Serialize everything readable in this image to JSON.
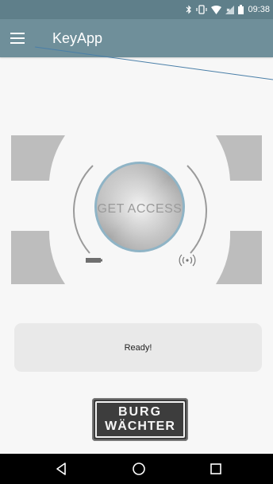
{
  "status_bar": {
    "time": "09:38",
    "icons": [
      "bluetooth-icon",
      "vibrate-icon",
      "wifi-icon",
      "signal-icon",
      "battery-icon"
    ]
  },
  "app_bar": {
    "title": "KeyApp",
    "menu_icon": "hamburger-menu-icon"
  },
  "access_control": {
    "button_label": "GET ACCESS",
    "battery_icon": "battery-icon",
    "signal_icon": "radio-signal-icon"
  },
  "status_message": "Ready!",
  "logo": {
    "line1": "BURG",
    "line2": "WÄCHTER"
  },
  "nav_bar": {
    "back": "back-triangle-icon",
    "home": "home-circle-icon",
    "recent": "recent-apps-square-icon"
  },
  "colors": {
    "status_bar": "#5f7f8a",
    "app_bar": "#6f8f9a",
    "background": "#f7f7f7",
    "panel_gray": "#bdbdbd",
    "ring_blue": "#8fb4c6"
  }
}
